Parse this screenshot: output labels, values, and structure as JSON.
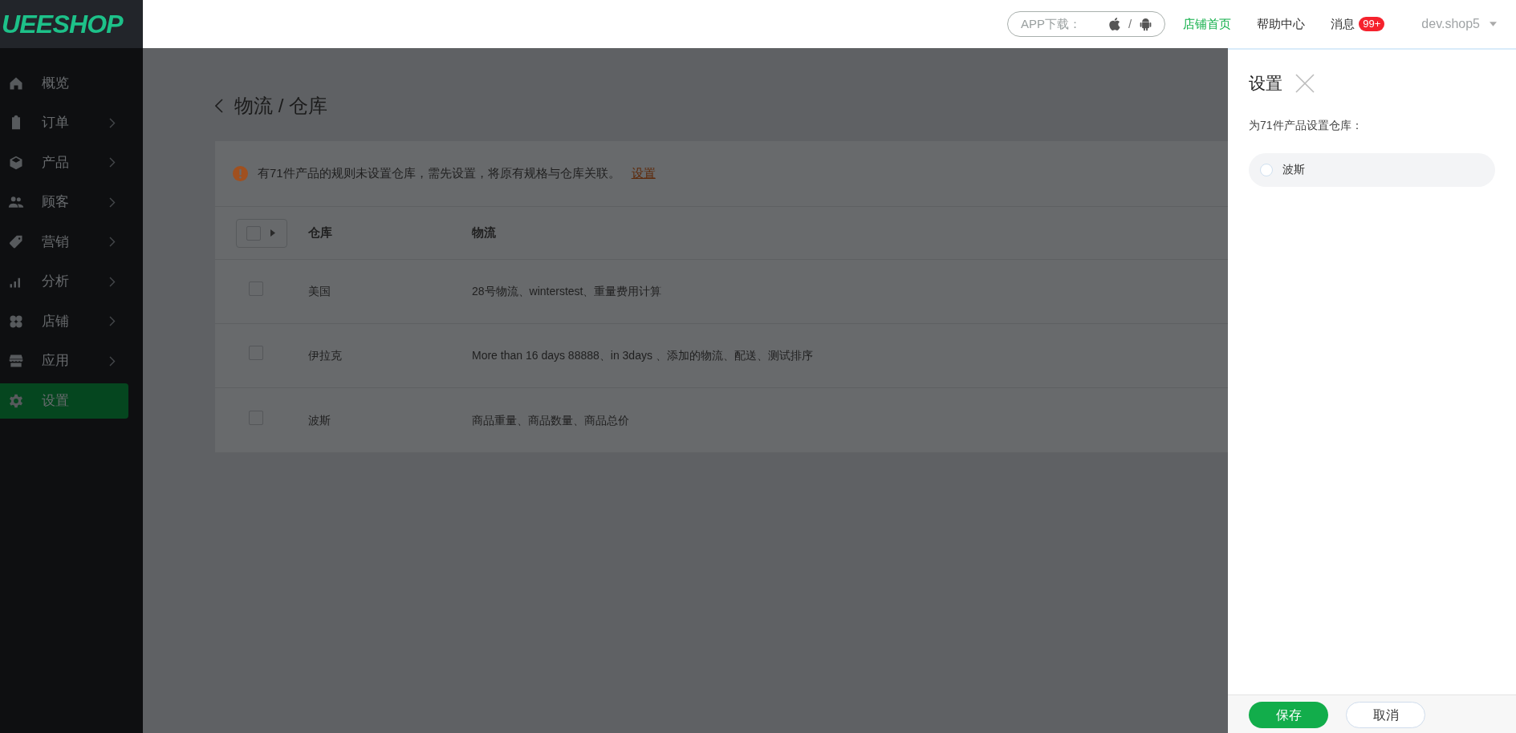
{
  "logo": "UEESHOP",
  "topbar": {
    "app_download": {
      "label": "APP下载：",
      "separator": "/"
    },
    "links": [
      {
        "label": "店铺首页",
        "selected": true
      },
      {
        "label": "帮助中心",
        "selected": false
      },
      {
        "label": "消息",
        "selected": false,
        "badge": "99+"
      }
    ],
    "user": "dev.shop5"
  },
  "sidebar": {
    "items": [
      {
        "label": "概览",
        "has_submenu": false,
        "selected": false
      },
      {
        "label": "订单",
        "has_submenu": true,
        "selected": false
      },
      {
        "label": "产品",
        "has_submenu": true,
        "selected": false
      },
      {
        "label": "顾客",
        "has_submenu": true,
        "selected": false
      },
      {
        "label": "营销",
        "has_submenu": true,
        "selected": false
      },
      {
        "label": "分析",
        "has_submenu": true,
        "selected": false
      },
      {
        "label": "店铺",
        "has_submenu": true,
        "selected": false
      },
      {
        "label": "应用",
        "has_submenu": true,
        "selected": false
      },
      {
        "label": "设置",
        "has_submenu": false,
        "selected": true
      }
    ]
  },
  "page": {
    "title": "物流 / 仓库",
    "notice": {
      "text": "有71件产品的规则未设置仓库，需先设置，将原有规格与仓库关联。",
      "link": "设置"
    },
    "table": {
      "select_all_checked": false,
      "columns": [
        "仓库",
        "物流"
      ],
      "rows": [
        {
          "checked": false,
          "cells": [
            "美国",
            "28号物流、winterstest、重量费用计算"
          ]
        },
        {
          "checked": false,
          "cells": [
            "伊拉克",
            "More than 16 days 88888、in 3days 、添加的物流、配送、测试排序"
          ]
        },
        {
          "checked": false,
          "cells": [
            "波斯",
            "商品重量、商品数量、商品总价"
          ]
        }
      ]
    }
  },
  "panel": {
    "title": "设置",
    "prompt": "为71件产品设置仓库：",
    "options": [
      {
        "label": "波斯",
        "selected": false
      }
    ],
    "buttons": [
      {
        "kind": "primary",
        "label": "保存"
      },
      {
        "kind": "secondary",
        "label": "取消"
      }
    ]
  }
}
